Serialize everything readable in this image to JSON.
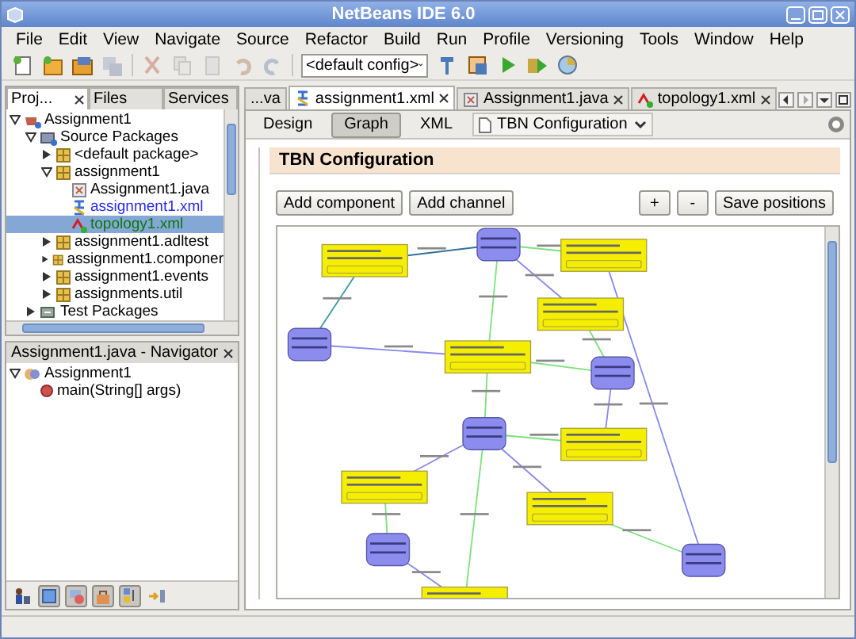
{
  "window": {
    "title": "NetBeans IDE 6.0"
  },
  "menu": [
    "File",
    "Edit",
    "View",
    "Navigate",
    "Source",
    "Refactor",
    "Build",
    "Run",
    "Profile",
    "Versioning",
    "Tools",
    "Window",
    "Help"
  ],
  "toolbar": {
    "config": "<default config>",
    "left": [
      {
        "kind": "new-file",
        "disabled": false
      },
      {
        "kind": "new-project",
        "disabled": false
      },
      {
        "kind": "open-project",
        "disabled": false
      },
      {
        "kind": "close-project",
        "disabled": true
      },
      {
        "kind": "cut",
        "disabled": true
      },
      {
        "kind": "copy",
        "disabled": true
      },
      {
        "kind": "paste",
        "disabled": true
      },
      {
        "kind": "undo",
        "disabled": true
      },
      {
        "kind": "redo",
        "disabled": true
      }
    ],
    "right": [
      {
        "kind": "build",
        "disabled": false
      },
      {
        "kind": "clean-build",
        "disabled": false
      },
      {
        "kind": "run",
        "disabled": false
      },
      {
        "kind": "debug",
        "disabled": false
      },
      {
        "kind": "profile",
        "disabled": false
      }
    ]
  },
  "projects": {
    "tabs": [
      {
        "label": "Proj...",
        "selected": true
      },
      {
        "label": "Files",
        "selected": false
      },
      {
        "label": "Services",
        "selected": false
      }
    ],
    "tree": [
      {
        "label": "Assignment1",
        "kind": "project",
        "expanded": true,
        "selected": false,
        "children": [
          {
            "label": "Source Packages",
            "kind": "source-root",
            "expanded": true,
            "selected": false,
            "children": [
              {
                "label": "<default package>",
                "kind": "package",
                "expanded": false,
                "selected": false
              },
              {
                "label": "assignment1",
                "kind": "package",
                "expanded": true,
                "selected": false,
                "children": [
                  {
                    "label": "Assignment1.java",
                    "kind": "java",
                    "selected": false,
                    "modified": false,
                    "added": false
                  },
                  {
                    "label": "assignment1.xml",
                    "kind": "xml",
                    "selected": false,
                    "modified": true,
                    "added": false
                  },
                  {
                    "label": "topology1.xml",
                    "kind": "topology",
                    "selected": true,
                    "modified": false,
                    "added": true
                  }
                ]
              },
              {
                "label": "assignment1.adltest",
                "kind": "package",
                "expanded": false,
                "selected": false
              },
              {
                "label": "assignment1.componer",
                "kind": "package",
                "expanded": false,
                "selected": false
              },
              {
                "label": "assignment1.events",
                "kind": "package",
                "expanded": false,
                "selected": false
              },
              {
                "label": "assignments.util",
                "kind": "package",
                "expanded": false,
                "selected": false
              }
            ]
          },
          {
            "label": "Test Packages",
            "kind": "test-root",
            "expanded": false,
            "selected": false
          }
        ]
      }
    ]
  },
  "navigator": {
    "title": "Assignment1.java - Navigator",
    "tree": [
      {
        "label": "Assignment1",
        "kind": "class",
        "expanded": true,
        "selected": false,
        "children": [
          {
            "label": "main(String[] args)",
            "kind": "method",
            "selected": false
          }
        ]
      }
    ],
    "tools": [
      {
        "kind": "people",
        "pressed": false
      },
      {
        "kind": "square",
        "pressed": true
      },
      {
        "kind": "shapes",
        "pressed": true
      },
      {
        "kind": "lock",
        "pressed": true
      },
      {
        "kind": "sort",
        "pressed": true
      },
      {
        "kind": "arrow",
        "pressed": false
      }
    ]
  },
  "editor": {
    "tabs": [
      {
        "label": "...va",
        "kind": "none",
        "selected": false,
        "closable": false
      },
      {
        "label": "assignment1.xml",
        "kind": "xml",
        "selected": true,
        "closable": true
      },
      {
        "label": "Assignment1.java",
        "kind": "java",
        "selected": false,
        "closable": true
      },
      {
        "label": "topology1.xml",
        "kind": "topology",
        "selected": false,
        "closable": true
      }
    ],
    "views": [
      {
        "label": "Design",
        "selected": false
      },
      {
        "label": "Graph",
        "selected": true
      },
      {
        "label": "XML",
        "selected": false
      }
    ],
    "section": "TBN Configuration",
    "panel": {
      "title": "TBN Configuration",
      "left_buttons": [
        "Add component",
        "Add channel"
      ],
      "right_buttons": [
        "+",
        "-",
        "Save positions"
      ]
    }
  }
}
